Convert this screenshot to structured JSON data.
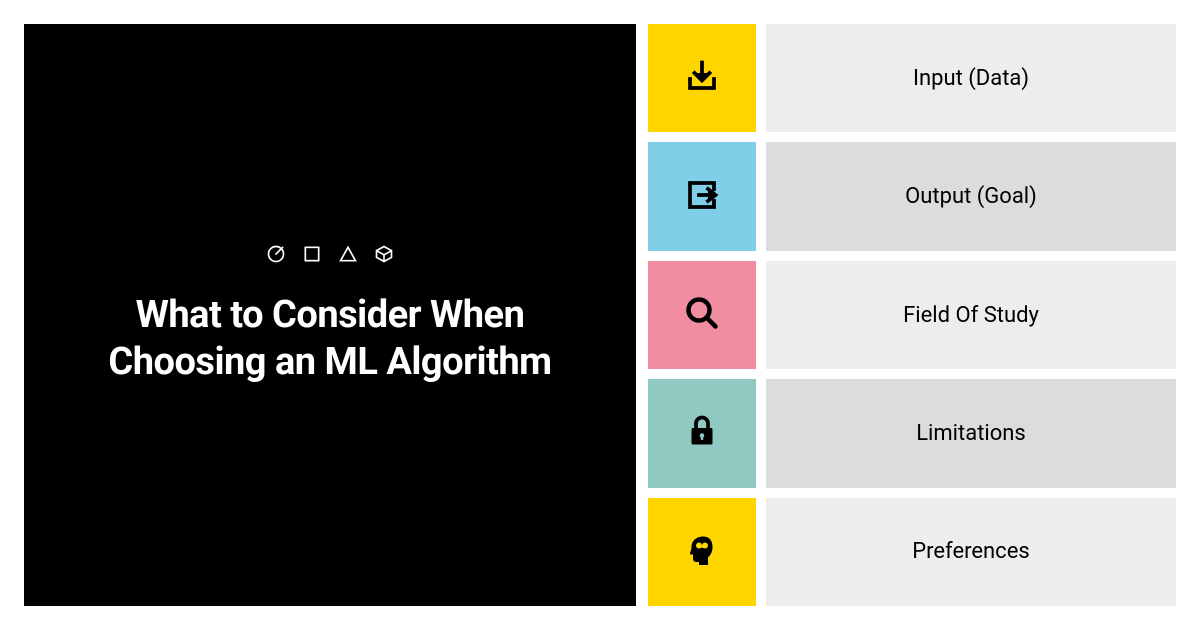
{
  "title": "What to Consider When Choosing an ML Algorithm",
  "items": [
    {
      "label": "Input (Data)",
      "icon_color": "#ffd500",
      "label_bg": "#ededed"
    },
    {
      "label": "Output (Goal)",
      "icon_color": "#7fcfe8",
      "label_bg": "#dcdcdc"
    },
    {
      "label": "Field Of Study",
      "icon_color": "#f18da1",
      "label_bg": "#ededed"
    },
    {
      "label": "Limitations",
      "icon_color": "#8fc9c2",
      "label_bg": "#dcdcdc"
    },
    {
      "label": "Preferences",
      "icon_color": "#ffd500",
      "label_bg": "#ededed"
    }
  ]
}
